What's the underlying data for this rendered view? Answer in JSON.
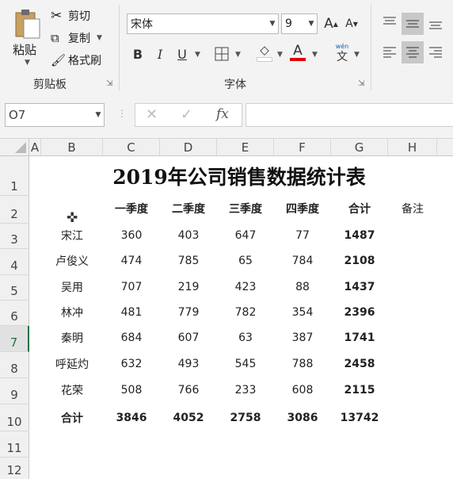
{
  "clipboard": {
    "paste": "粘贴",
    "cut": "剪切",
    "copy": "复制",
    "format_painter": "格式刷",
    "group": "剪贴板"
  },
  "font": {
    "name": "宋体",
    "size": "9",
    "grow": "A",
    "shrink": "A",
    "bold": "B",
    "italic": "I",
    "underline": "U",
    "wen_top": "wén",
    "wen": "文",
    "font_color_letter": "A",
    "group": "字体"
  },
  "formula_bar": {
    "name_box": "O7",
    "fx": "fx",
    "formula": ""
  },
  "columns": [
    "A",
    "B",
    "C",
    "D",
    "E",
    "F",
    "G",
    "H"
  ],
  "rows": [
    "1",
    "2",
    "3",
    "4",
    "5",
    "6",
    "7",
    "8",
    "9",
    "10",
    "11",
    "12"
  ],
  "selected_row": "7",
  "sheet": {
    "title": "2019年公司销售数据统计表",
    "headers": [
      "一季度",
      "二季度",
      "三季度",
      "四季度",
      "合计",
      "备注"
    ],
    "data": [
      {
        "name": "宋江",
        "q1": "360",
        "q2": "403",
        "q3": "647",
        "q4": "77",
        "total": "1487"
      },
      {
        "name": "卢俊义",
        "q1": "474",
        "q2": "785",
        "q3": "65",
        "q4": "784",
        "total": "2108"
      },
      {
        "name": "吴用",
        "q1": "707",
        "q2": "219",
        "q3": "423",
        "q4": "88",
        "total": "1437"
      },
      {
        "name": "林冲",
        "q1": "481",
        "q2": "779",
        "q3": "782",
        "q4": "354",
        "total": "2396"
      },
      {
        "name": "秦明",
        "q1": "684",
        "q2": "607",
        "q3": "63",
        "q4": "387",
        "total": "1741"
      },
      {
        "name": "呼延灼",
        "q1": "632",
        "q2": "493",
        "q3": "545",
        "q4": "788",
        "total": "2458"
      },
      {
        "name": "花荣",
        "q1": "508",
        "q2": "766",
        "q3": "233",
        "q4": "608",
        "total": "2115"
      }
    ],
    "total_row": {
      "name": "合计",
      "q1": "3846",
      "q2": "4052",
      "q3": "2758",
      "q4": "3086",
      "total": "13742"
    }
  },
  "colors": {
    "accent": "#217346",
    "font_color_bar": "#e00000"
  }
}
